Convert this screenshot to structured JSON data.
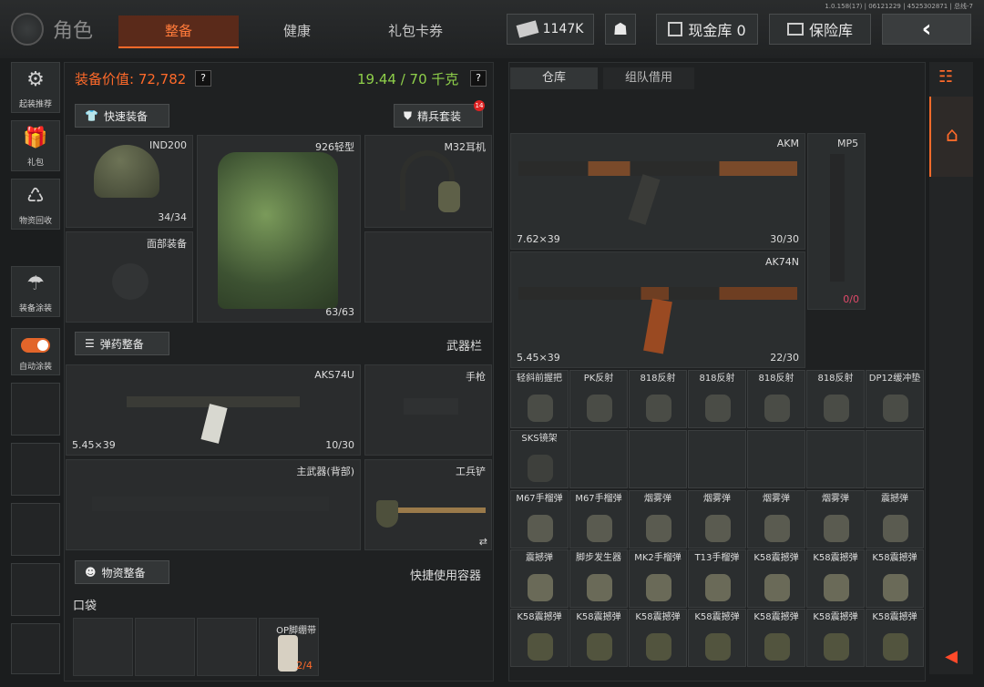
{
  "version": "1.0.158(17) | 06121229 | 4525302871 | 总线-7",
  "header": {
    "title": "角色",
    "tabs": [
      "整备",
      "健康",
      "礼包卡券"
    ],
    "money": "1147K",
    "cash_vault": "现金库 0",
    "safe": "保险库"
  },
  "sidebar": [
    "起装推荐",
    "礼包",
    "物资回收",
    "装备涂装",
    "自动涂装"
  ],
  "stats": {
    "value_label": "装备价值: 72,782",
    "weight": "19.44 / 70 千克",
    "q": "?"
  },
  "buttons": {
    "quick_equip": "快速装备",
    "elite_set": "精兵套装",
    "elite_badge": "14",
    "ammo_prep": "弹药整备",
    "supply_prep": "物资整备"
  },
  "labels": {
    "weapons": "武器栏",
    "quick_container": "快捷使用容器",
    "pocket": "口袋"
  },
  "slots": {
    "helmet": {
      "name": "IND200",
      "count": "34/34"
    },
    "face": {
      "name": "面部装备"
    },
    "armor": {
      "name": "926轻型",
      "count": "63/63"
    },
    "headset": {
      "name": "M32耳机"
    },
    "primary": {
      "name": "AKS74U",
      "caliber": "5.45×39",
      "count": "10/30"
    },
    "pistol": {
      "name": "手枪"
    },
    "back": {
      "name": "主武器(背部)"
    },
    "melee": {
      "name": "工兵铲"
    },
    "pocket_item": {
      "name": "OP脚绷带",
      "count": "2/4"
    }
  },
  "storage": {
    "tabs": [
      "仓库",
      "组队借用"
    ],
    "akm": {
      "name": "AKM",
      "caliber": "7.62×39",
      "count": "30/30"
    },
    "ak74n": {
      "name": "AK74N",
      "caliber": "5.45×39",
      "count": "22/30"
    },
    "mp5": {
      "name": "MP5",
      "count": "0/0"
    },
    "row1": [
      "轻斜前握把",
      "PK反射",
      "818反射",
      "818反射",
      "818反射",
      "818反射",
      "DP12缓冲垫"
    ],
    "row2": [
      "SKS镜架"
    ],
    "row3": [
      "M67手榴弹",
      "M67手榴弹",
      "烟雾弹",
      "烟雾弹",
      "烟雾弹",
      "烟雾弹",
      "震撼弹"
    ],
    "row4": [
      "震撼弹",
      "脚步发生器",
      "MK2手榴弹",
      "T13手榴弹",
      "K58震撼弹",
      "K58震撼弹",
      "K58震撼弹"
    ],
    "row5": [
      "K58震撼弹",
      "K58震撼弹",
      "K58震撼弹",
      "K58震撼弹",
      "K58震撼弹",
      "K58震撼弹",
      "K58震撼弹"
    ]
  },
  "colors": {
    "accent": "#ff6a2a",
    "weight": "#8fd04a",
    "value": "#ff6a2a"
  }
}
